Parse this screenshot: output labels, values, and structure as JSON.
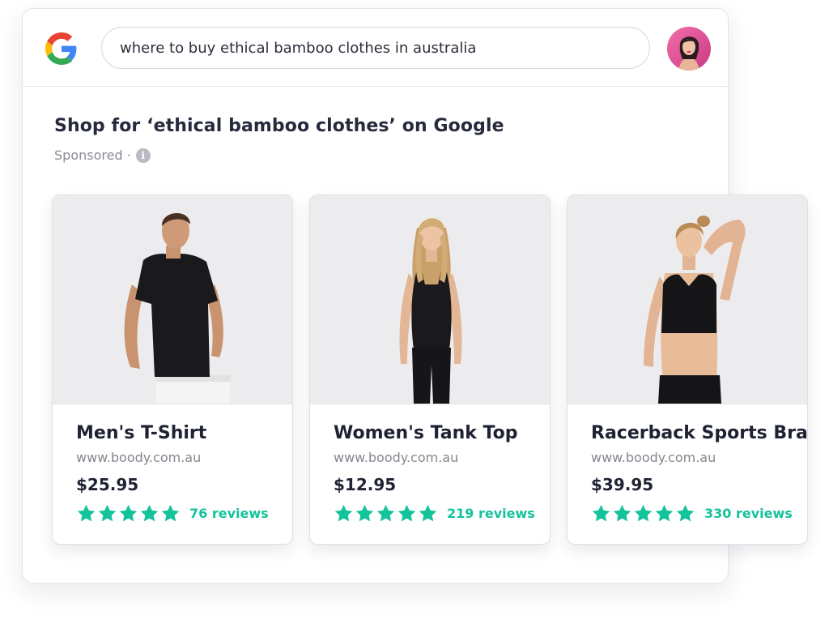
{
  "search": {
    "query": "where to buy ethical bamboo clothes in australia"
  },
  "results": {
    "title": "Shop for ‘ethical bamboo clothes’ on Google",
    "sponsored_label": "Sponsored ·",
    "info_icon_glyph": "i"
  },
  "colors": {
    "star": "#14c39a",
    "reviews_text": "#14c39a",
    "card_photo_bg": "#ececef"
  },
  "products": [
    {
      "name": "Men's T-Shirt",
      "url": "www.boody.com.au",
      "price": "$25.95",
      "rating_stars": 5,
      "reviews": "76 reviews",
      "image_icon": "mens-tshirt-model"
    },
    {
      "name": "Women's Tank Top",
      "url": "www.boody.com.au",
      "price": "$12.95",
      "rating_stars": 5,
      "reviews": "219 reviews",
      "image_icon": "womens-tank-model"
    },
    {
      "name": "Racerback Sports Bra",
      "url": "www.boody.com.au",
      "price": "$39.95",
      "rating_stars": 5,
      "reviews": "330 reviews",
      "image_icon": "sports-bra-model"
    }
  ]
}
